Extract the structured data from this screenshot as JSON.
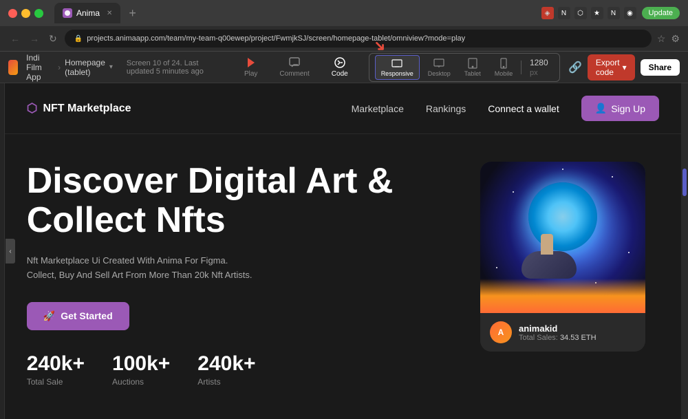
{
  "browser": {
    "tab_title": "Anima",
    "tab_favicon": "A",
    "address": "projects.animaapp.com/team/my-team-q00ewep/project/FwmjkSJ/screen/homepage-tablet/omniview?mode=play",
    "new_tab_icon": "+",
    "nav_back": "←",
    "nav_forward": "→",
    "nav_refresh": "↻",
    "update_label": "Update"
  },
  "anima_bar": {
    "logo_text": "Indi Film App",
    "breadcrumb_sep": "›",
    "project_name": "Homepage (tablet)",
    "project_arrow": "▾",
    "screen_info": "Screen 10 of 24. Last updated 5 minutes ago",
    "play_label": "Play",
    "comment_label": "Comment",
    "code_label": "Code",
    "responsive_label": "Responsive",
    "desktop_label": "Desktop",
    "tablet_label": "Tablet",
    "mobile_label": "Mobile",
    "dimension": "1280",
    "dimension_unit": "px",
    "export_label": "Export code",
    "share_label": "Share"
  },
  "nft_page": {
    "logo_text": "NFT Marketplace",
    "nav_links": [
      "Marketplace",
      "Rankings",
      "Connect a wallet"
    ],
    "signup_label": "Sign Up",
    "hero_title": "Discover Digital Art & Collect Nfts",
    "hero_desc": "Nft Marketplace Ui Created With Anima For Figma. Collect, Buy And Sell Art From More Than 20k Nft Artists.",
    "get_started_label": "Get Started",
    "stats": [
      {
        "value": "240k+",
        "label": "Total Sale"
      },
      {
        "value": "100k+",
        "label": "Auctions"
      },
      {
        "value": "240k+",
        "label": "Artists"
      }
    ],
    "nft_card": {
      "artist_name": "animakid",
      "sales_label": "Total Sales:",
      "eth_value": "34.53 ETH"
    }
  }
}
